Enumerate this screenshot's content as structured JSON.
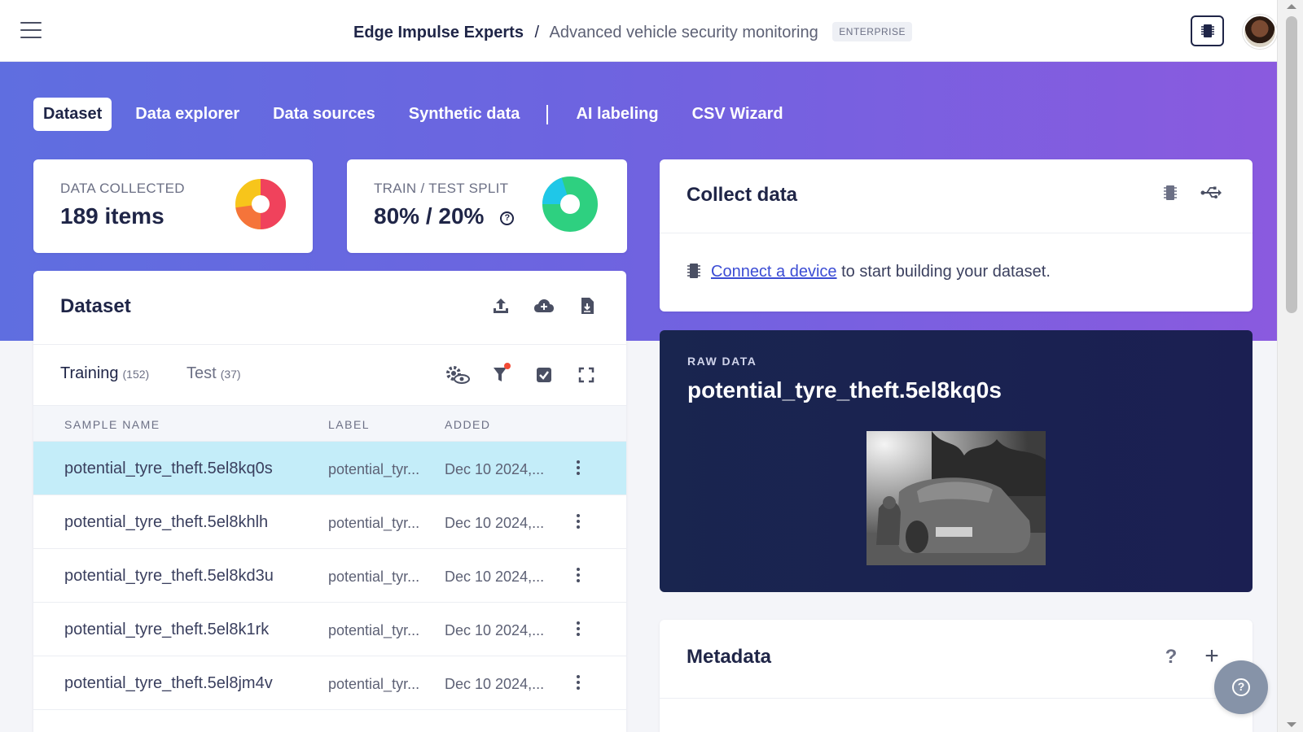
{
  "header": {
    "org": "Edge Impulse Experts",
    "separator": "/",
    "project": "Advanced vehicle security monitoring",
    "badge": "ENTERPRISE"
  },
  "tabs": [
    {
      "label": "Dataset",
      "active": true
    },
    {
      "label": "Data explorer"
    },
    {
      "label": "Data sources"
    },
    {
      "label": "Synthetic data"
    },
    {
      "label": "AI labeling"
    },
    {
      "label": "CSV Wizard"
    }
  ],
  "stats": {
    "collected_label": "DATA COLLECTED",
    "collected_value": "189 items",
    "split_label": "TRAIN / TEST SPLIT",
    "split_value": "80% / 20%",
    "help": "?"
  },
  "dataset": {
    "title": "Dataset",
    "training_label": "Training",
    "training_count": "(152)",
    "test_label": "Test",
    "test_count": "(37)",
    "columns": [
      "SAMPLE NAME",
      "LABEL",
      "ADDED"
    ],
    "rows": [
      {
        "name": "potential_tyre_theft.5el8kq0s",
        "label": "potential_tyr...",
        "added": "Dec 10 2024,...",
        "selected": true
      },
      {
        "name": "potential_tyre_theft.5el8khlh",
        "label": "potential_tyr...",
        "added": "Dec 10 2024,..."
      },
      {
        "name": "potential_tyre_theft.5el8kd3u",
        "label": "potential_tyr...",
        "added": "Dec 10 2024,..."
      },
      {
        "name": "potential_tyre_theft.5el8k1rk",
        "label": "potential_tyr...",
        "added": "Dec 10 2024,..."
      },
      {
        "name": "potential_tyre_theft.5el8jm4v",
        "label": "potential_tyr...",
        "added": "Dec 10 2024,..."
      }
    ]
  },
  "collect": {
    "title": "Collect data",
    "link_text": "Connect a device",
    "message_rest": " to start building your dataset."
  },
  "raw": {
    "label": "RAW DATA",
    "title": "potential_tyre_theft.5el8kq0s"
  },
  "metadata": {
    "title": "Metadata",
    "help": "?",
    "add": "+"
  },
  "colors": {
    "accent": "#5f6ee0",
    "selected_row": "#c4edf9",
    "link": "#3b4cd4"
  }
}
